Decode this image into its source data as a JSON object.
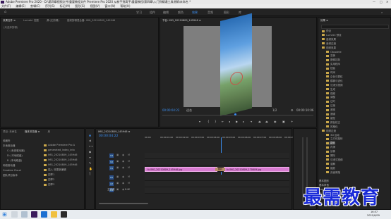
{
  "window": {
    "title": "Adobe Premiere Pro 2020 - D:\\第四章视频文件\\重要教程文件 Premiere Pro 2020 从新手到高手\\重要教程\\第四章\\入门到精通工具讲解\\未命名 *",
    "controls": [
      "—",
      "□",
      "✕"
    ]
  },
  "menu": [
    "文件(F)",
    "编辑(E)",
    "剪辑(C)",
    "序列(S)",
    "标记(M)",
    "图形(G)",
    "视图(V)",
    "窗口(W)",
    "帮助(H)"
  ],
  "workspaces": [
    "学习",
    "组件",
    "编辑",
    "颜色",
    "效果",
    "音频",
    "图形",
    "库"
  ],
  "workspace_active": "效果",
  "source_panel": {
    "tabs": [
      "效果控件 ≡",
      "Lumetri 范围",
      "源:(无剪辑)",
      "音频剪辑混合器: IMG_20210809_145946"
    ],
    "placeholder": "(未选择剪辑)"
  },
  "program_panel": {
    "tab": "节目: IMG_20210809_145946 ≡",
    "timecode_left": "00:00:04:22",
    "fit": "适合",
    "quality": "1/2",
    "timecode_right": "00:00:10:06"
  },
  "effects_panel": {
    "title": "效果 ≡",
    "items": [
      "预设",
      "Lumetri 预设",
      "音频效果",
      "音频过渡",
      "视频效果",
      "Obsolete",
      "变换",
      "图像控制",
      "实用程序",
      "扭曲",
      "时间",
      "杂色与颗粒",
      "模糊与锐化",
      "沉浸式视频",
      "生成",
      "视频",
      "调整",
      "过时",
      "过渡",
      "透视",
      "通道",
      "键控",
      "颜色校正",
      "风格化",
      "视频过渡",
      "3D 运动",
      "立方体旋转",
      "翻转",
      "内滑",
      "划像",
      "擦除",
      "沉浸式视频",
      "溶解",
      "缩放",
      "页面剥落"
    ],
    "selected": "翻转",
    "footer_items": [
      "基本图形",
      "基本声音",
      "Lumetri 颜色",
      "库",
      "标记"
    ]
  },
  "project_panel": {
    "tabs": [
      "项目: 未命名",
      "媒体浏览器 ≡",
      "库"
    ],
    "tree": [
      "收藏夹",
      "本地驱动器",
      "C: (系统驱动器)",
      "D: (本地磁盘)",
      "E: (本地磁盘)",
      "网络驱动器",
      "Creative Cloud",
      "团队项目版本"
    ],
    "files": [
      "Adobe Premiere Pro A",
      "generated_index_info",
      "IMG_20210809_145946",
      "IMG_20210809_145946",
      "IMG_20210809_145946",
      "插入 效果新编辑",
      "四季1",
      "四季2",
      "四季3"
    ]
  },
  "timeline": {
    "tab": "IMG_20210809_145946 ≡",
    "timecode": "00:00:04:22",
    "ruler": [
      "00:00",
      "00:00:01:00",
      "00:00:02:00",
      "00:00:03:00",
      "00:00:04:00",
      "00:00:05:00",
      "00:00:06:00",
      "00:00:07:00",
      "00:00:08:00",
      "00:00:09:00"
    ],
    "tracks": [
      "V3",
      "V2",
      "V1",
      "A1",
      "A2",
      "A3"
    ],
    "master": "主声道",
    "master_value": "0.0",
    "clip1": "fx IMG_20210809_145946.jpg",
    "clip2": "fx IMG_20210809_170609.jpg",
    "transition": "翻转"
  },
  "taskbar": {
    "time": "16:57",
    "date": "2021/8/09"
  },
  "watermark": "最需教育",
  "colors": {
    "accent": "#3b8ef0",
    "clip": "#d77bd0"
  }
}
